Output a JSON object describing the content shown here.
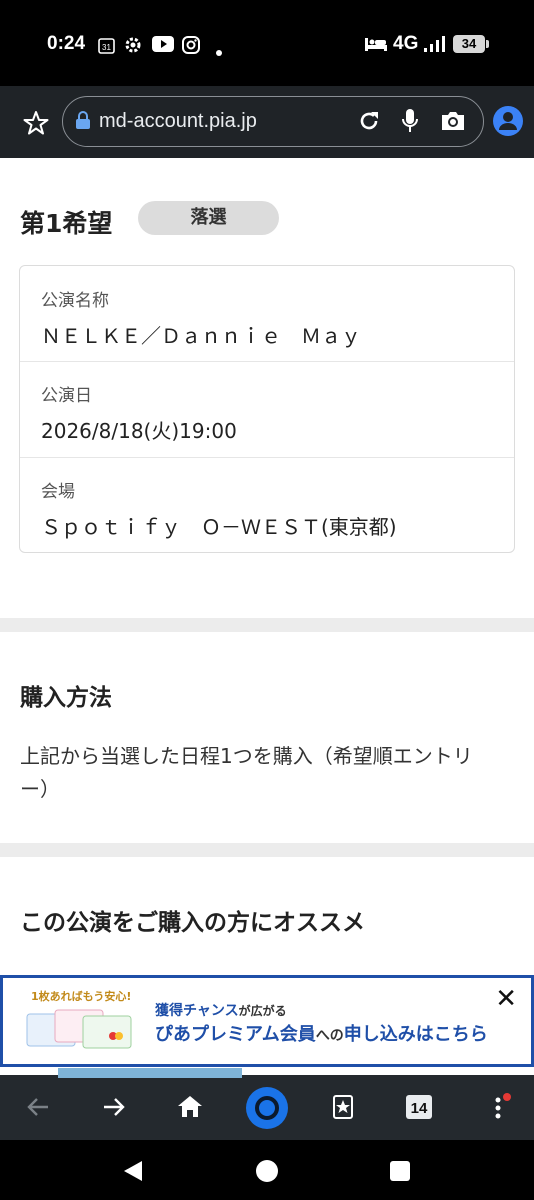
{
  "status_bar": {
    "time": "0:24",
    "calendar_day": "31",
    "network": "4G",
    "battery": "34"
  },
  "browser": {
    "url": "md-account.pia.jp",
    "tab_count": "14"
  },
  "choice": {
    "title": "第1希望",
    "status": "落選"
  },
  "details": [
    {
      "label": "公演名称",
      "value": "ＮＥＬＫＥ／Ｄａｎｎｉｅ　Ｍａｙ"
    },
    {
      "label": "公演日",
      "value": "2026/8/18(火)19:00"
    },
    {
      "label": "会場",
      "value": "Ｓｐｏｔｉｆｙ　Ｏ－ＷＥＳＴ(東京都)"
    }
  ],
  "purchase": {
    "heading": "購入方法",
    "line1": "上記から当選した日程1つを購入（希望順エントリ",
    "line2": "ー）"
  },
  "recommend": {
    "heading": "この公演をご購入の方にオススメ"
  },
  "banner": {
    "small": "1枚あればもう安心!",
    "line1_a": "獲得チャンス",
    "line1_b": "が広がる",
    "line2_a": "ぴあプレミアム会員",
    "line2_b": "への",
    "line2_c": "申し込みはこちら",
    "close": "✕"
  },
  "colors": {
    "accent": "#1f4fa8",
    "badge_bg": "#dcdcdc",
    "toolbar_bg": "#1f2327",
    "nav_highlight": "#1a73e8"
  }
}
